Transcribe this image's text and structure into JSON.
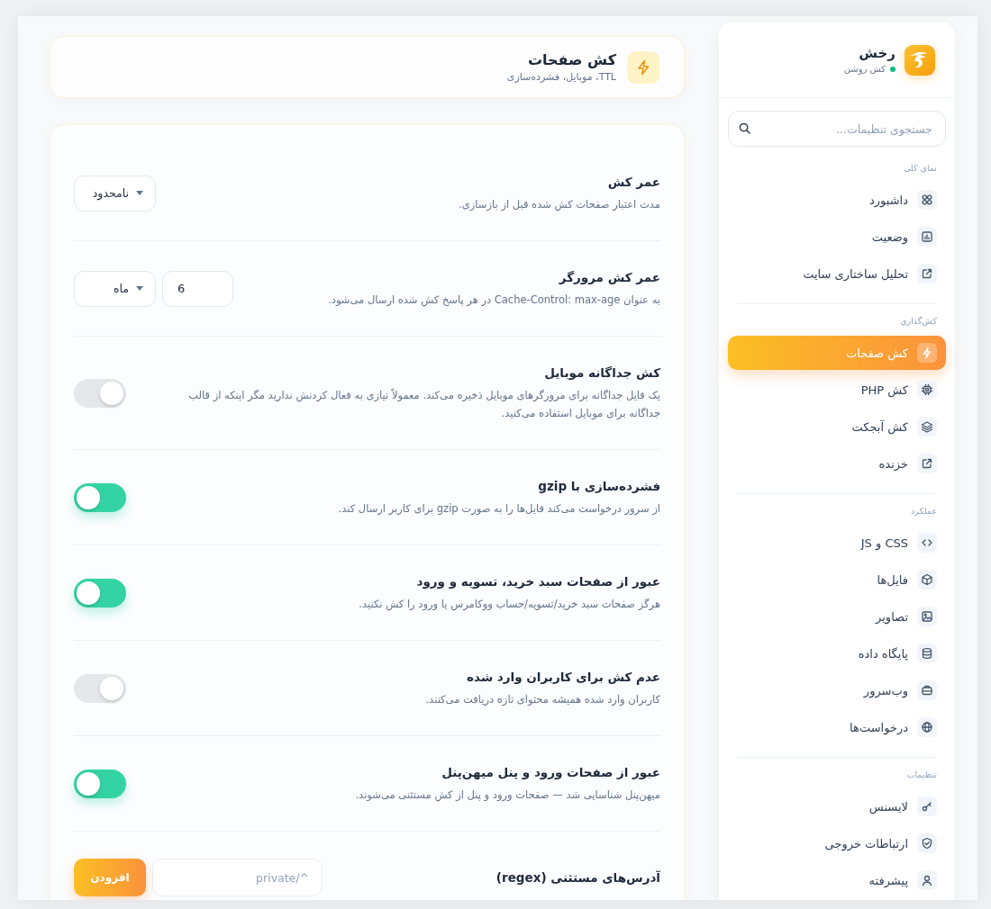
{
  "sidebar": {
    "brand": {
      "name": "رخش",
      "status": "کش روشن",
      "active": true
    },
    "search": {
      "placeholder": "جستجوی تنظیمات..."
    },
    "sections": [
      {
        "title": "نمای کلی",
        "items": [
          {
            "label": "داشبورد",
            "selected": false
          },
          {
            "label": "وضعیت",
            "selected": false
          },
          {
            "label": "تحلیل ساختاری سایت",
            "selected": false
          }
        ]
      },
      {
        "title": "کش‌گذاری",
        "items": [
          {
            "label": "کش صفحات",
            "selected": true
          },
          {
            "label": "کش PHP",
            "selected": false
          },
          {
            "label": "کش آبجکت",
            "selected": false
          },
          {
            "label": "خزنده",
            "selected": false
          }
        ]
      },
      {
        "title": "عملکرد",
        "items": [
          {
            "label": "CSS و JS",
            "selected": false
          },
          {
            "label": "فایل‌ها",
            "selected": false
          },
          {
            "label": "تصاویر",
            "selected": false
          },
          {
            "label": "پایگاه داده",
            "selected": false
          },
          {
            "label": "وب‌سرور",
            "selected": false
          },
          {
            "label": "درخواست‌ها",
            "selected": false
          }
        ]
      },
      {
        "title": "تنظیمات",
        "items": [
          {
            "label": "لایسنس",
            "selected": false
          },
          {
            "label": "ارتباطات خروجی",
            "selected": false
          },
          {
            "label": "پیشرفته",
            "selected": false
          }
        ]
      }
    ]
  },
  "header": {
    "title": "کش صفحات",
    "subtitle": "TTL، موبایل، فشرده‌سازی"
  },
  "settings": [
    {
      "kind": "select",
      "title": "عمر کش",
      "description": "مدت اعتبار صفحات کش شده قبل از بازسازی.",
      "value": "نامحدود"
    },
    {
      "kind": "duration",
      "title": "عمر کش مرورگر",
      "description": "به عنوان Cache-Control: max-age در هر پاسخ کش شده ارسال می‌شود.",
      "number": "6",
      "unit": "ماه"
    },
    {
      "kind": "toggle",
      "title": "کش جداگانه موبایل",
      "description": "یک فایل جداگانه برای مرورگرهای موبایل ذخیره می‌کند. معمولاً نیازی به فعال کردنش ندارید مگر اینکه از قالب جداگانه برای موبایل استفاده می‌کنید.",
      "on": false
    },
    {
      "kind": "toggle",
      "title": "فشرده‌سازی با gzip",
      "description": "از سرور درخواست می‌کند فایل‌ها را به صورت gzip برای کاربر ارسال کند.",
      "on": true
    },
    {
      "kind": "toggle",
      "title": "عبور از صفحات سبد خرید، تسویه و ورود",
      "description": "هرگز صفحات سبد خرید/تسویه/حساب ووکامرس یا ورود را کش نکنید.",
      "on": true
    },
    {
      "kind": "toggle",
      "title": "عدم کش برای کاربران وارد شده",
      "description": "کاربران وارد شده همیشه محتوای تازه دریافت می‌کنند.",
      "on": false
    },
    {
      "kind": "toggle",
      "title": "عبور از صفحات ورود و پنل میهن‌پنل",
      "description": "میهن‌پنل شناسایی شد — صفحات ورود و پنل از کش مستثنی می‌شوند.",
      "on": true
    },
    {
      "kind": "pattern",
      "title": "آدرس‌های مستثنی (regex)",
      "placeholder": "^/private",
      "button": "افزودن"
    }
  ]
}
